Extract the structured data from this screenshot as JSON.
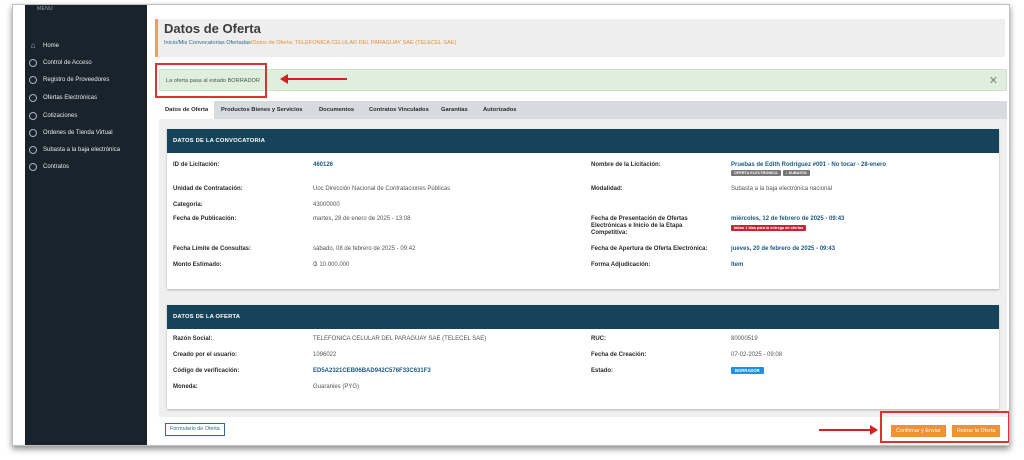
{
  "sidebar": {
    "menu_label": "MENU",
    "items": [
      {
        "label": "Home",
        "icon": "home-icon"
      },
      {
        "label": "Control de Acceso",
        "icon": "circle-icon"
      },
      {
        "label": "Registro de Proveedores",
        "icon": "circle-icon"
      },
      {
        "label": "Ofertas Electrónicas",
        "icon": "circle-icon"
      },
      {
        "label": "Cotizaciones",
        "icon": "circle-icon"
      },
      {
        "label": "Ordenes de Tienda Virtual",
        "icon": "circle-icon"
      },
      {
        "label": "Subasta a la baja electrónica",
        "icon": "circle-icon"
      },
      {
        "label": "Contratos",
        "icon": "circle-icon"
      }
    ]
  },
  "header": {
    "title": "Datos de Oferta",
    "crumb_home": "Inicio",
    "crumb_sep": "/",
    "crumb_convocatorias": "Mis Convocatorias Ofertadas",
    "crumb_current": "Datos de Oferta: TELEFONICA CELULAR DEL PARAGUAY SAE (TELECEL SAE)"
  },
  "alert": {
    "message": "La oferta pasa al estado BORRADOR",
    "close": "✕"
  },
  "tabs": [
    "Datos de Oferta",
    "Productos Bienes y Servicios",
    "Documentos",
    "Contratos Vinculados",
    "Garantías",
    "Autorizados"
  ],
  "convocatoria": {
    "heading": "DATOS DE LA CONVOCATORIA",
    "id_label": "ID de Licitación:",
    "id_value": "460126",
    "nombre_label": "Nombre de la Licitación:",
    "nombre_value": "Pruebas de Edith Rodriguez #001 - No tocar - 28-enero",
    "badge_oferta": "OFERTA ELECTRÓNICA",
    "badge_subasta": "♪ SUBASTA",
    "unidad_label": "Unidad de Contratación:",
    "unidad_value": "Uoc Dirección Nacional de Contrataciones Públicas",
    "modalidad_label": "Modalidad:",
    "modalidad_value": "Subasta a la baja electrónica nacional",
    "categoria_label": "Categoría:",
    "categoria_value": "43000000",
    "pub_label": "Fecha de Publicación:",
    "pub_value": "martes, 28 de enero de 2025 - 13:08",
    "present_label_1": "Fecha de Presentación de Ofertas",
    "present_label_2": "Electrónicas e Inicio de la Etapa",
    "present_label_3": "Competitiva:",
    "present_value": "miércoles, 12 de febrero de 2025 - 09:43",
    "present_badge": "faltan 1 días para la entrega de ofertas",
    "limite_label": "Fecha Límite de Consultas:",
    "limite_value": "sábado, 08 de febrero de 2025 - 09:42",
    "apertura_label": "Fecha de Apertura de Oferta Electrónica:",
    "apertura_value": "jueves, 20 de febrero de 2025 - 09:43",
    "monto_label": "Monto Estimado:",
    "monto_value": "₲ 10.000.000",
    "forma_label": "Forma Adjudicación:",
    "forma_value": "Item"
  },
  "oferta": {
    "heading": "DATOS DE LA OFERTA",
    "razon_label": "Razón Social:",
    "razon_value": "TELEFONICA CELULAR DEL PARAGUAY SAE (TELECEL SAE)",
    "ruc_label": "RUC:",
    "ruc_value": "80000519",
    "creado_label": "Creado por el usuario:",
    "creado_value": "1096022",
    "fecha_label": "Fecha de Creación:",
    "fecha_value": "07-02-2025 - 09:08",
    "codigo_label": "Código de verificación:",
    "codigo_value": "ED5A2321CEB06BAD942C576F33C631F3",
    "estado_label": "Estado:",
    "estado_value": "BORRADOR",
    "moneda_label": "Moneda:",
    "moneda_value": "Guaranies (PYG)"
  },
  "footer": {
    "formulario": "Formulario de Oferta",
    "confirmar": "Confirmar y Enviar",
    "retirar": "Retirar la Oferta"
  },
  "colors": {
    "annotation": "#e03030",
    "accent": "#f0913a",
    "header_bar": "#15445a"
  }
}
